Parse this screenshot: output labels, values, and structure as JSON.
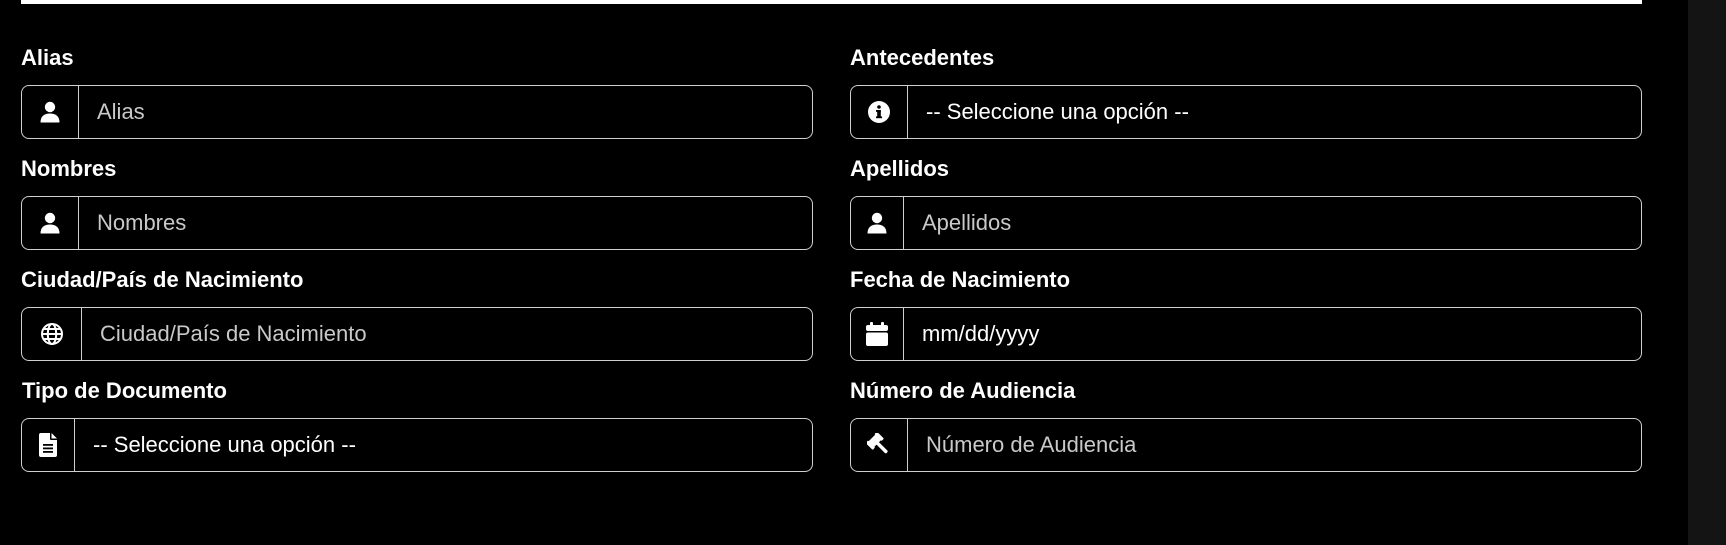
{
  "form": {
    "fields": {
      "alias": {
        "label": "Alias",
        "placeholder": "Alias",
        "icon": "user-icon"
      },
      "antecedentes": {
        "label": "Antecedentes",
        "selected": "-- Seleccione una opción --",
        "icon": "info-circle-icon"
      },
      "nombres": {
        "label": "Nombres",
        "placeholder": "Nombres",
        "icon": "user-icon"
      },
      "apellidos": {
        "label": "Apellidos",
        "placeholder": "Apellidos",
        "icon": "user-icon"
      },
      "ciudad": {
        "label": "Ciudad/País de Nacimiento",
        "placeholder": "Ciudad/País de Nacimiento",
        "icon": "globe-icon"
      },
      "fecha": {
        "label": "Fecha de Nacimiento",
        "value": "mm/dd/yyyy",
        "icon": "calendar-icon"
      },
      "tipo_documento": {
        "label": "Tipo de Documento",
        "selected": "-- Seleccione una opción --",
        "icon": "document-icon"
      },
      "numero_audiencia": {
        "label": "Número de Audiencia",
        "placeholder": "Número de Audiencia",
        "icon": "gavel-icon"
      }
    }
  },
  "colors": {
    "background": "#000000",
    "text": "#ffffff",
    "border": "#cfcfcf",
    "placeholder": "#c9c9c9"
  }
}
